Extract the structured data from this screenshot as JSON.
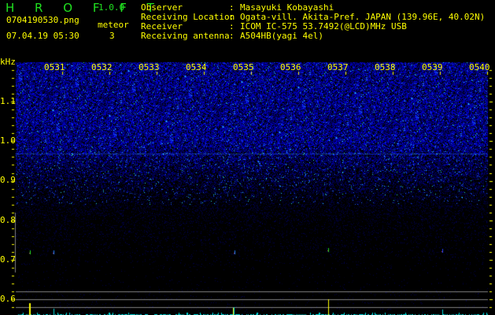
{
  "header": {
    "app_title": "H R O F F T",
    "version": "1.0.0",
    "filename": "0704190530.png",
    "datetime": "07.04.19 05:30",
    "meteor_label": "meteor",
    "meteor_count": "3"
  },
  "info": [
    {
      "label": "Observer",
      "value": "Masayuki Kobayashi"
    },
    {
      "label": "Receiving Location",
      "value": "Ogata-vill. Akita-Pref. JAPAN (139.96E, 40.02N)"
    },
    {
      "label": "Receiver",
      "value": "ICOM IC-575 53.7492(@LCD)MHz USB"
    },
    {
      "label": "Receiving antenna",
      "value": "A504HB(yagi 4el)"
    }
  ],
  "axis": {
    "unit": "kHz",
    "y_labels": [
      "1.1",
      "1.0",
      "0.9",
      "0.8",
      "0.7",
      "0.6"
    ],
    "time_labels": [
      "0531",
      "0532",
      "0533",
      "0534",
      "0535",
      "0536",
      "0537",
      "0538",
      "0539",
      "0540"
    ]
  },
  "colors": {
    "text": "#ffff00",
    "title": "#20e020",
    "noise": "#1030ff",
    "histogram": "#00e0e0",
    "grid": "#808080"
  }
}
